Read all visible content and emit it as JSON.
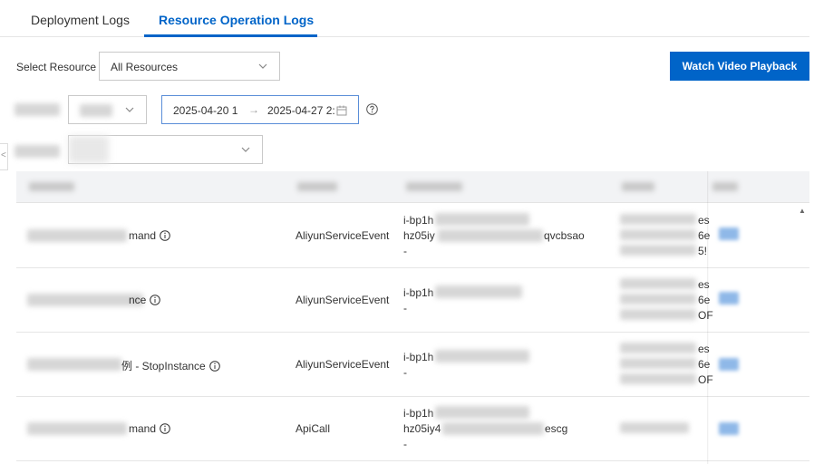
{
  "tabs": {
    "deployment": "Deployment Logs",
    "resource_operation": "Resource Operation Logs"
  },
  "filters": {
    "resource_label": "Select Resource",
    "resource_value": "All Resources",
    "date_start": "2025-04-20 1",
    "date_arrow": "→",
    "date_end": "2025-04-27 2:"
  },
  "actions": {
    "watch_video": "Watch Video Playback"
  },
  "table": {
    "rows": [
      {
        "name_suffix": "mand",
        "source": "AliyunServiceEvent",
        "res_line1": "i-bp1h",
        "res_line2a": "hz05iy",
        "res_line2b": "qvcbsao",
        "res_line3": "-",
        "col5_frag1": "es",
        "col5_frag2": "6e",
        "col5_frag3": "5!"
      },
      {
        "name_suffix": "nce",
        "source": "AliyunServiceEvent",
        "res_line1": "i-bp1h",
        "res_line2a": "-",
        "res_line2b": "",
        "res_line3": "",
        "col5_frag1": "es",
        "col5_frag2": "6e",
        "col5_frag3": "OF"
      },
      {
        "name_suffix": "例 - StopInstance",
        "source": "AliyunServiceEvent",
        "res_line1": "i-bp1h",
        "res_line2a": "-",
        "res_line2b": "",
        "res_line3": "",
        "col5_frag1": "es",
        "col5_frag2": "6e",
        "col5_frag3": "OF"
      },
      {
        "name_suffix": "mand",
        "source": "ApiCall",
        "res_line1": "i-bp1h",
        "res_line2a": "hz05iy4",
        "res_line2b": "escg",
        "res_line3": "-",
        "col5_frag1": "",
        "col5_frag2": "",
        "col5_frag3": ""
      }
    ]
  },
  "colors": {
    "primary": "#0064c8",
    "header_bg": "#f2f3f5"
  },
  "icons": [
    "chevron-down-icon",
    "calendar-icon",
    "help-circle-icon",
    "info-icon",
    "collapse-left-icon",
    "scroll-up-icon"
  ]
}
